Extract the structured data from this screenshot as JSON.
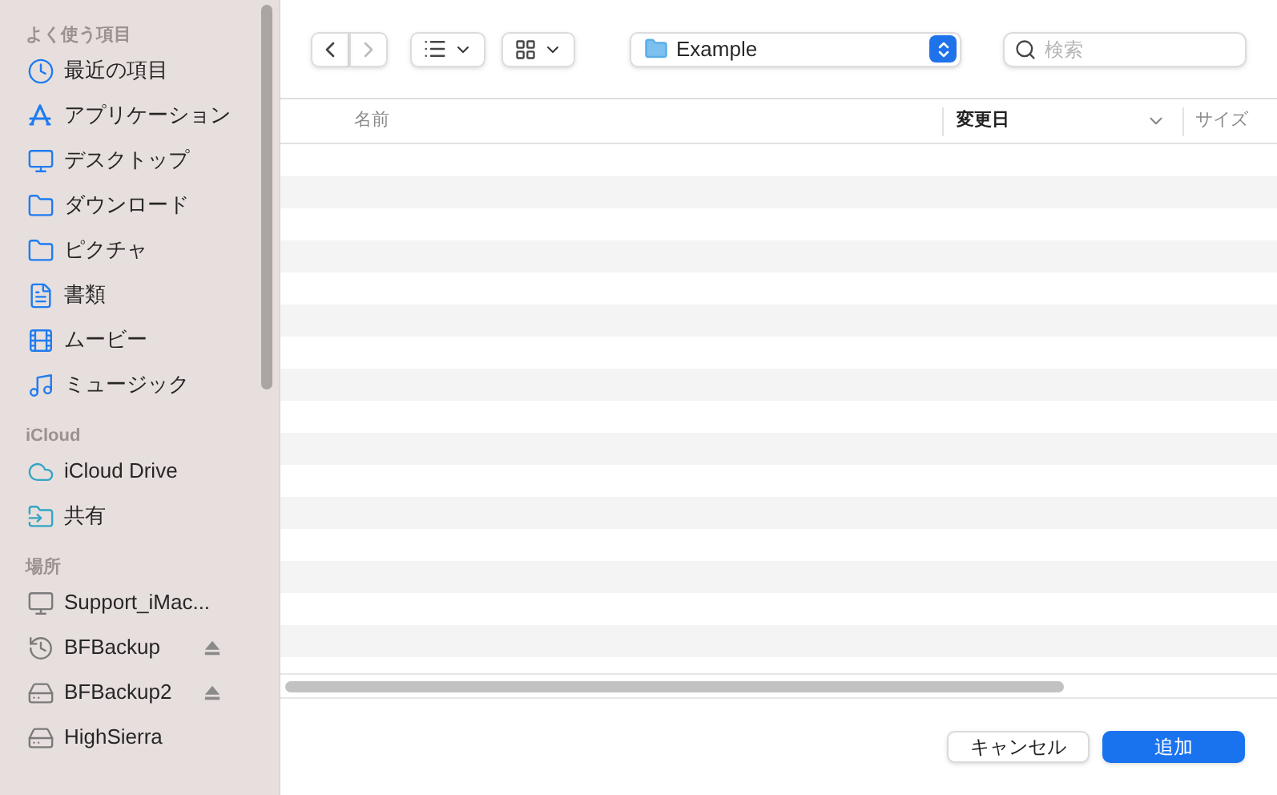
{
  "sidebar": {
    "sections": [
      {
        "kind": "favorites",
        "title": "よく使う項目",
        "items": [
          {
            "label": "最近の項目",
            "eject": false
          },
          {
            "label": "アプリケーション",
            "eject": false
          },
          {
            "label": "デスクトップ",
            "eject": false
          },
          {
            "label": "ダウンロード",
            "eject": false
          },
          {
            "label": "ピクチャ",
            "eject": false
          },
          {
            "label": "書類",
            "eject": false
          },
          {
            "label": "ムービー",
            "eject": false
          },
          {
            "label": "ミュージック",
            "eject": false
          }
        ]
      },
      {
        "kind": "icloud",
        "title": "iCloud",
        "items": [
          {
            "label": "iCloud Drive",
            "eject": false
          },
          {
            "label": "共有",
            "eject": false
          }
        ]
      },
      {
        "kind": "places",
        "title": "場所",
        "items": [
          {
            "label": "Support_iMac...",
            "eject": false
          },
          {
            "label": "BFBackup",
            "eject": true
          },
          {
            "label": "BFBackup2",
            "eject": true
          },
          {
            "label": "HighSierra",
            "eject": false
          }
        ]
      }
    ]
  },
  "toolbar": {
    "location": "Example",
    "search": {
      "placeholder": "検索"
    }
  },
  "table": {
    "columns": [
      {
        "label": "名前",
        "sorted": false
      },
      {
        "label": "変更日",
        "sorted": true
      },
      {
        "label": "サイズ",
        "sorted": false
      }
    ]
  },
  "buttons": [
    {
      "label": "キャンセル",
      "primary": false
    },
    {
      "label": "追加",
      "primary": true
    }
  ]
}
